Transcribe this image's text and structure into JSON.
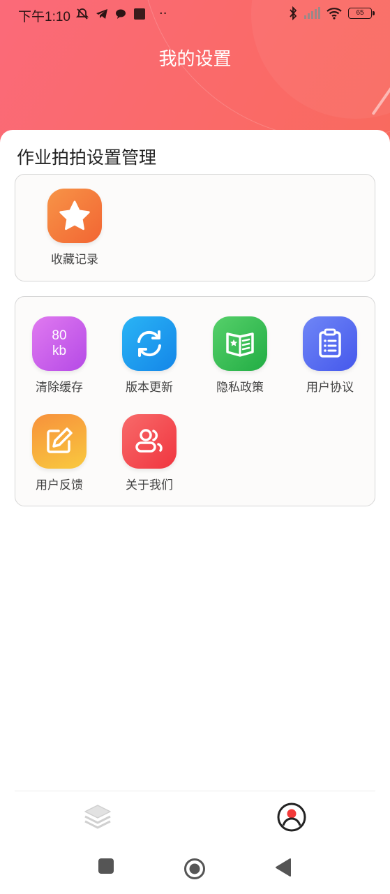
{
  "status_bar": {
    "time": "下午1:10",
    "dots": "··",
    "battery": "65",
    "icons": [
      "mute-bell-icon",
      "telegram-icon",
      "chat-icon",
      "app-icon",
      "bluetooth-icon",
      "signal-icon",
      "wifi-icon",
      "battery-icon"
    ]
  },
  "header": {
    "title": "我的设置"
  },
  "section": {
    "title": "作业拍拍设置管理"
  },
  "panel1": {
    "items": [
      {
        "label": "收藏记录",
        "icon": "star-icon",
        "color": "#f7763f"
      }
    ]
  },
  "panel2": {
    "items": [
      {
        "label": "清除缓存",
        "icon": "cache-icon",
        "badge_top": "80",
        "badge_bottom": "kb",
        "color": "#c55ae6"
      },
      {
        "label": "版本更新",
        "icon": "refresh-icon",
        "color": "#1e9cf0"
      },
      {
        "label": "隐私政策",
        "icon": "book-icon",
        "color": "#3fc05a"
      },
      {
        "label": "用户协议",
        "icon": "clipboard-icon",
        "color": "#5870f2"
      },
      {
        "label": "用户反馈",
        "icon": "edit-icon",
        "color": "#f7a83a"
      },
      {
        "label": "关于我们",
        "icon": "users-icon",
        "color": "#f5474f"
      }
    ]
  },
  "tabbar": {
    "items": [
      {
        "name": "layers-tab",
        "icon": "layers-icon",
        "active": false
      },
      {
        "name": "profile-tab",
        "icon": "profile-icon",
        "active": true
      }
    ]
  },
  "navbar": {
    "buttons": [
      "square-icon",
      "home-circle-icon",
      "back-triangle-icon"
    ]
  }
}
